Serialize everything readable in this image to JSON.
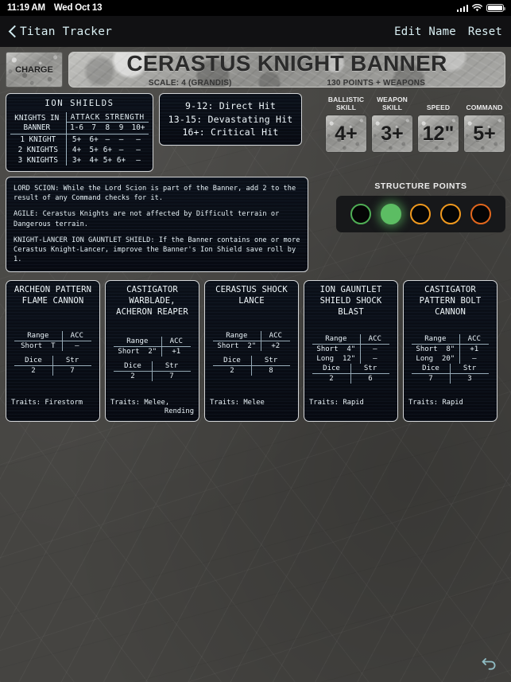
{
  "status_bar": {
    "time": "11:19 AM",
    "date": "Wed Oct 13",
    "signal_icon": "cellular-bars-icon",
    "wifi_icon": "wifi-icon",
    "battery_icon": "battery-full-icon"
  },
  "nav": {
    "back_icon": "chevron-left-icon",
    "back_label": "Titan Tracker",
    "edit_name_label": "Edit Name",
    "reset_label": "Reset"
  },
  "title": {
    "charge_label": "CHARGE",
    "name": "CERASTUS KNIGHT BANNER",
    "scale": "SCALE: 4 (GRANDIS)",
    "points": "130 POINTS + WEAPONS"
  },
  "ion_shields": {
    "title": "ION SHIELDS",
    "row_header": [
      "KNIGHTS IN",
      "BANNER"
    ],
    "group_header": "ATTACK STRENGTH",
    "columns": [
      "1-6",
      "7",
      "8",
      "9",
      "10+"
    ],
    "rows": [
      {
        "label": "1 KNIGHT",
        "values": [
          "5+",
          "6+",
          "–",
          "–",
          "–"
        ]
      },
      {
        "label": "2 KNIGHTS",
        "values": [
          "4+",
          "5+",
          "6+",
          "–",
          "–"
        ]
      },
      {
        "label": "3 KNIGHTS",
        "values": [
          "3+",
          "4+",
          "5+",
          "6+",
          "–"
        ]
      }
    ]
  },
  "hit_table": {
    "lines": [
      "9-12: Direct Hit",
      "13-15: Devastating Hit",
      "16+: Critical Hit"
    ]
  },
  "stats": [
    {
      "label_line1": "BALLISTIC",
      "label_line2": "SKILL",
      "value": "4+"
    },
    {
      "label_line1": "WEAPON",
      "label_line2": "SKILL",
      "value": "3+"
    },
    {
      "label_line1": "",
      "label_line2": "SPEED",
      "value": "12\""
    },
    {
      "label_line1": "",
      "label_line2": "COMMAND",
      "value": "5+"
    }
  ],
  "rules": [
    "LORD SCION: While the Lord Scion is part of the Banner, add 2 to the result of any Command checks for it.",
    "AGILE: Cerastus Knights are not affected by Difficult terrain or Dangerous terrain.",
    "KNIGHT-LANCER ION GAUNTLET SHIELD: If the Banner contains one or more Cerastus Knight-Lancer, improve the Banner's Ion Shield save roll by 1."
  ],
  "structure_points": {
    "title": "STRUCTURE POINTS",
    "dots": [
      {
        "state": "outline",
        "color": "#4fae55"
      },
      {
        "state": "filled",
        "color": "#5cbd63"
      },
      {
        "state": "outline",
        "color": "#f0991e"
      },
      {
        "state": "outline",
        "color": "#f0991e"
      },
      {
        "state": "outline",
        "color": "#e2671d"
      }
    ]
  },
  "weapons": [
    {
      "name": [
        "ARCHEON PATTERN",
        "FLAME CANNON"
      ],
      "range_header": "Range",
      "acc_header": "ACC",
      "ranges": [
        {
          "label": "Short",
          "value": "T",
          "acc": "–"
        }
      ],
      "dice_header": "Dice",
      "str_header": "Str",
      "dice": "2",
      "str": "7",
      "traits_label": "Traits:",
      "traits": [
        "Firestorm"
      ]
    },
    {
      "name": [
        "CASTIGATOR",
        "WARBLADE,",
        "ACHERON REAPER"
      ],
      "range_header": "Range",
      "acc_header": "ACC",
      "ranges": [
        {
          "label": "Short",
          "value": "2\"",
          "acc": "+1"
        }
      ],
      "dice_header": "Dice",
      "str_header": "Str",
      "dice": "2",
      "str": "7",
      "traits_label": "Traits:",
      "traits": [
        "Melee,",
        "Rending"
      ]
    },
    {
      "name": [
        "CERASTUS SHOCK",
        "LANCE"
      ],
      "range_header": "Range",
      "acc_header": "ACC",
      "ranges": [
        {
          "label": "Short",
          "value": "2\"",
          "acc": "+2"
        }
      ],
      "dice_header": "Dice",
      "str_header": "Str",
      "dice": "2",
      "str": "8",
      "traits_label": "Traits:",
      "traits": [
        "Melee"
      ]
    },
    {
      "name": [
        "ION GAUNTLET",
        "SHIELD SHOCK",
        "BLAST"
      ],
      "range_header": "Range",
      "acc_header": "ACC",
      "ranges": [
        {
          "label": "Short",
          "value": "4\"",
          "acc": "–"
        },
        {
          "label": "Long",
          "value": "12\"",
          "acc": "–"
        }
      ],
      "dice_header": "Dice",
      "str_header": "Str",
      "dice": "2",
      "str": "6",
      "traits_label": "Traits:",
      "traits": [
        "Rapid"
      ]
    },
    {
      "name": [
        "CASTIGATOR",
        "PATTERN BOLT",
        "CANNON"
      ],
      "range_header": "Range",
      "acc_header": "ACC",
      "ranges": [
        {
          "label": "Short",
          "value": "8\"",
          "acc": "+1"
        },
        {
          "label": "Long",
          "value": "20\"",
          "acc": "–"
        }
      ],
      "dice_header": "Dice",
      "str_header": "Str",
      "dice": "7",
      "str": "3",
      "traits_label": "Traits:",
      "traits": [
        "Rapid"
      ]
    }
  ],
  "bottom": {
    "undo_icon": "undo-arrow-icon"
  }
}
